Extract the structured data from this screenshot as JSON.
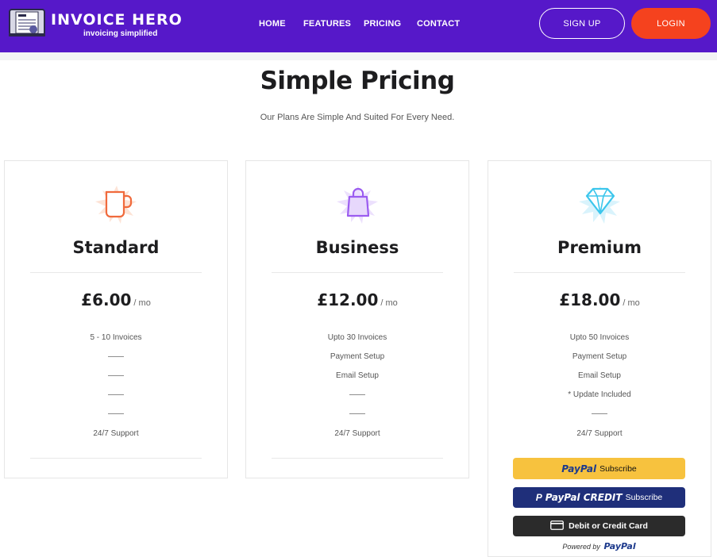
{
  "brand": {
    "name": "INVOICE HERO",
    "tagline": "invoicing simplified"
  },
  "nav": {
    "links": [
      "HOME",
      "FEATURES",
      "PRICING",
      "CONTACT"
    ],
    "signup": "SIGN UP",
    "login": "LOGIN"
  },
  "header": {
    "title": "Simple Pricing",
    "subtitle": "Our Plans Are Simple And Suited For Every Need."
  },
  "plans": [
    {
      "name": "Standard",
      "price": "£6.00",
      "period": "/ mo",
      "icon": "mug-icon",
      "accent": "#f06a3c",
      "features": [
        "5 - 10 Invoices",
        "——",
        "——",
        "——",
        "——",
        "24/7 Support"
      ]
    },
    {
      "name": "Business",
      "price": "£12.00",
      "period": "/ mo",
      "icon": "shopping-bag-icon",
      "accent": "#9b5cf0",
      "features": [
        "Upto 30 Invoices",
        "Payment Setup",
        "Email Setup",
        "——",
        "——",
        "24/7 Support"
      ]
    },
    {
      "name": "Premium",
      "price": "£18.00",
      "period": "/ mo",
      "icon": "diamond-icon",
      "accent": "#3cc6ec",
      "features": [
        "Upto 50 Invoices",
        "Payment Setup",
        "Email Setup",
        "* Update Included",
        "——",
        "24/7 Support"
      ]
    }
  ],
  "paypal": {
    "subscribe_brand": "PayPal",
    "subscribe_label": "Subscribe",
    "credit_brand": "PayPal CREDIT",
    "credit_label": "Subscribe",
    "card_label": "Debit or Credit Card",
    "powered_prefix": "Powered by",
    "powered_brand": "PayPal"
  },
  "colors": {
    "nav_bg": "#5618c9",
    "login_bg": "#f5421e",
    "paypal_yellow": "#f7c23e",
    "paypal_blue": "#1f2f7a"
  }
}
